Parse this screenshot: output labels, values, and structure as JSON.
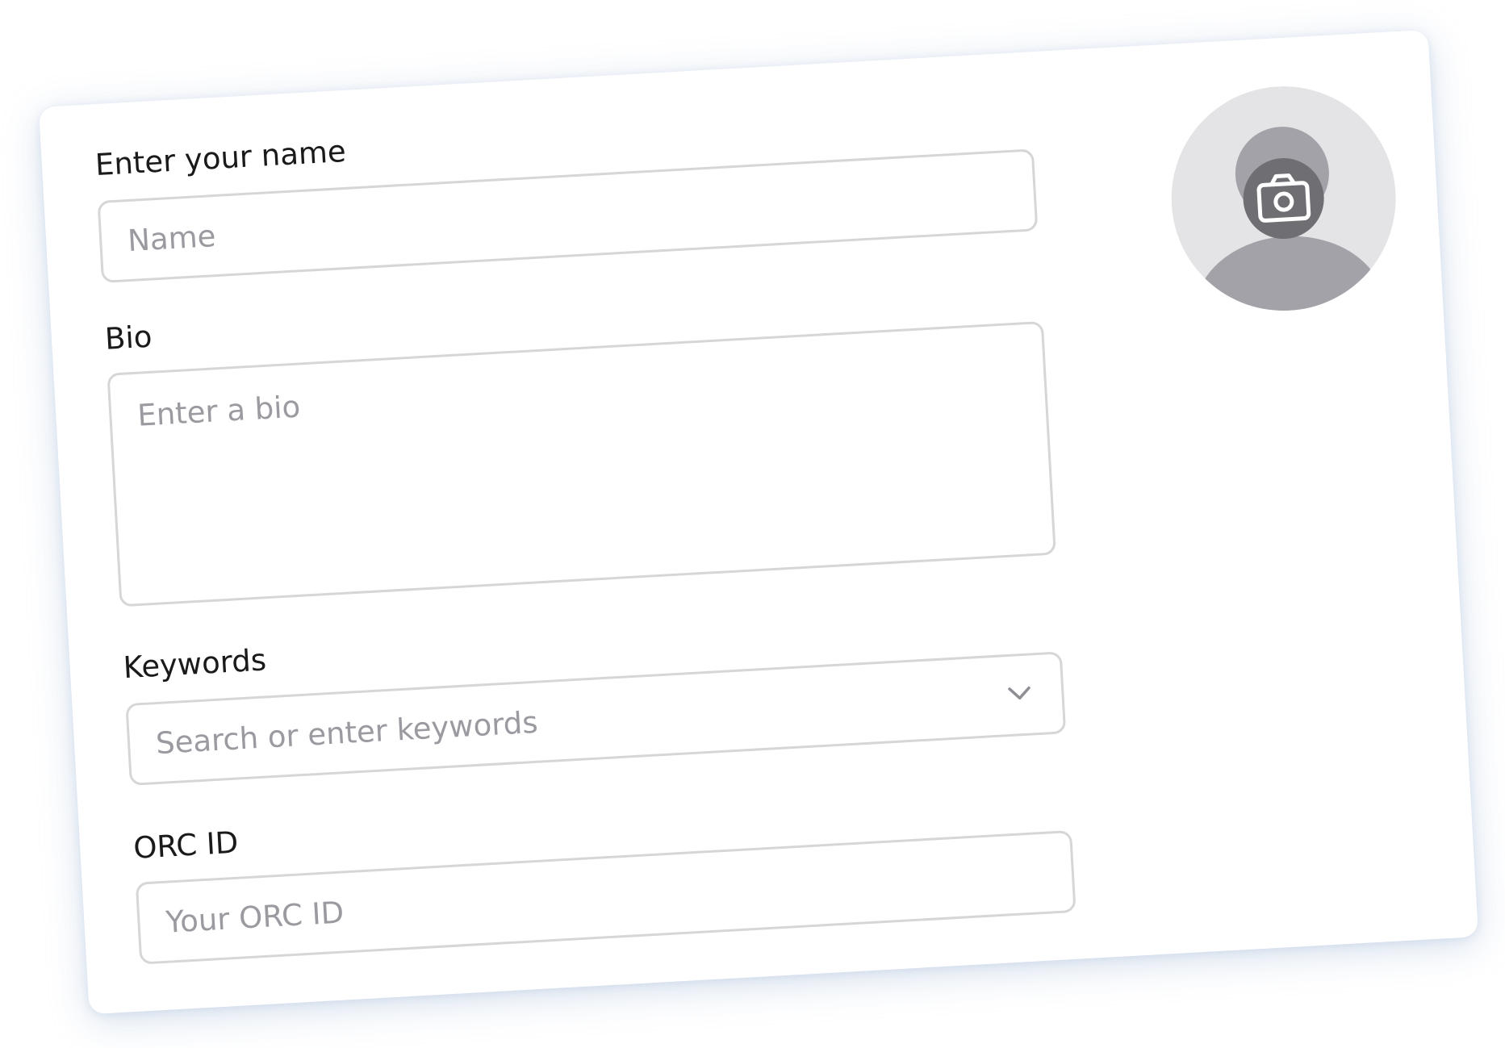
{
  "form": {
    "name": {
      "label": "Enter your name",
      "placeholder": "Name",
      "value": ""
    },
    "bio": {
      "label": "Bio",
      "placeholder": "Enter a bio",
      "value": ""
    },
    "keywords": {
      "label": "Keywords",
      "placeholder": "Search or enter keywords",
      "value": "",
      "icon": "chevron-down-icon"
    },
    "orcid": {
      "label": "ORC ID",
      "placeholder": "Your ORC ID",
      "value": ""
    }
  },
  "avatar": {
    "icon": "camera-icon",
    "placeholder_icon": "user-silhouette-icon"
  },
  "colors": {
    "label_text": "#1a1a1a",
    "placeholder_text": "#9a9aa0",
    "field_border": "#d6d6d8",
    "avatar_background": "#e4e4e6",
    "avatar_silhouette": "#a2a2a8",
    "camera_badge": "#6f6f73",
    "camera_glyph": "#ffffff",
    "shadow": "#96afd2"
  }
}
